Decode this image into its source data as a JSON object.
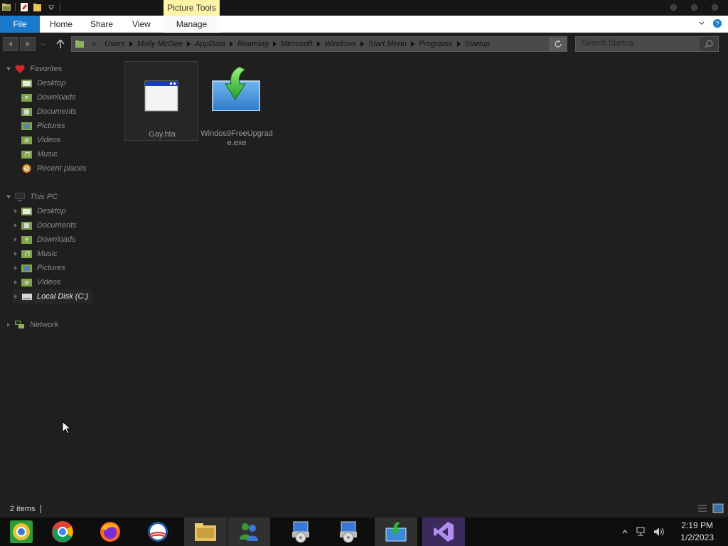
{
  "titlebar": {
    "context_tab": "Picture Tools"
  },
  "ribbon": {
    "tabs": [
      {
        "label": "File"
      },
      {
        "label": "Home"
      },
      {
        "label": "Share"
      },
      {
        "label": "View"
      },
      {
        "label": "Manage"
      }
    ]
  },
  "address": {
    "crumbs": [
      "Users",
      "Molly McGee",
      "AppData",
      "Roaming",
      "Microsoft",
      "Windows",
      "Start Menu",
      "Programs",
      "Startup"
    ],
    "overflow": "«"
  },
  "search": {
    "placeholder": "Search Startup"
  },
  "sidebar": {
    "favorites": {
      "label": "Favorites",
      "items": [
        "Desktop",
        "Downloads",
        "Documents",
        "Pictures",
        "Videos",
        "Music",
        "Recent places"
      ]
    },
    "this_pc": {
      "label": "This PC",
      "items": [
        "Desktop",
        "Documents",
        "Downloads",
        "Music",
        "Pictures",
        "Videos",
        "Local Disk (C:)"
      ]
    },
    "network": {
      "label": "Network"
    }
  },
  "files": [
    {
      "name": "Gay.hta",
      "icon": "hta-window-icon",
      "selected": true
    },
    {
      "name": "Windos9FreeUpgrade.exe",
      "icon": "installer-download-icon",
      "selected": false
    }
  ],
  "status": {
    "count": "2 items"
  },
  "taskbar": {
    "apps": [
      {
        "name": "chromium-icon"
      },
      {
        "name": "chrome-icon"
      },
      {
        "name": "firefox-icon"
      },
      {
        "name": "obama-logo-icon"
      },
      {
        "name": "file-explorer-icon"
      },
      {
        "name": "msn-messenger-icon"
      },
      {
        "name": "setup-installer-icon"
      },
      {
        "name": "setup-installer-icon"
      },
      {
        "name": "windows-upgrade-icon"
      },
      {
        "name": "visual-studio-icon"
      }
    ],
    "clock": {
      "time": "2:19 PM",
      "date": "1/2/2023"
    }
  },
  "colors": {
    "file_tab": "#1979ca",
    "context_tab": "#fff3a6",
    "background": "#1f1f1f"
  }
}
